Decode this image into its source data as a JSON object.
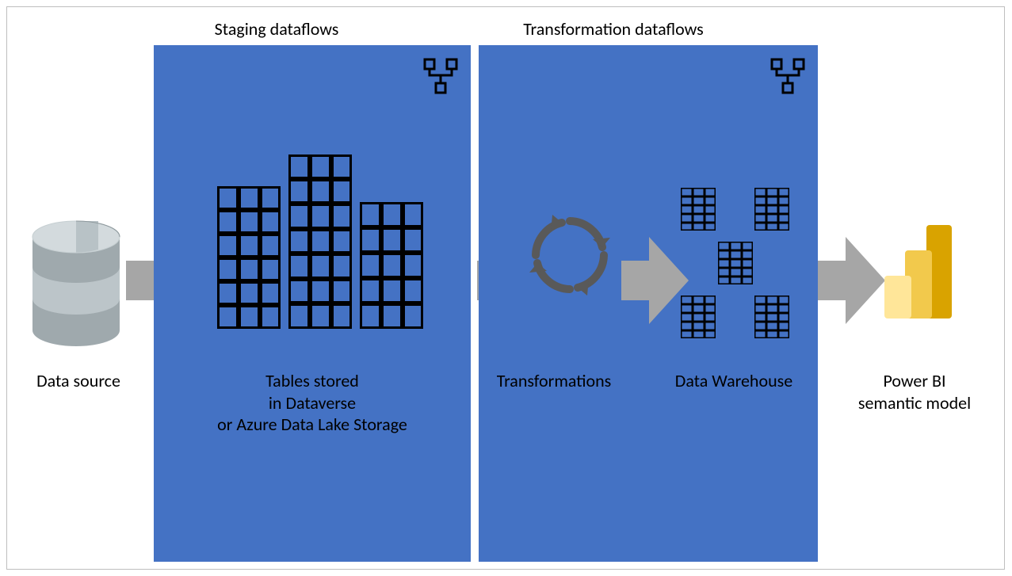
{
  "titles": {
    "staging": "Staging dataflows",
    "transformation": "Transformation dataflows"
  },
  "labels": {
    "data_source": "Data source",
    "tables": "Tables stored\nin Dataverse\nor Azure Data Lake Storage",
    "transformations": "Transformations",
    "warehouse": "Data Warehouse",
    "powerbi": "Power BI\nsemantic model"
  }
}
